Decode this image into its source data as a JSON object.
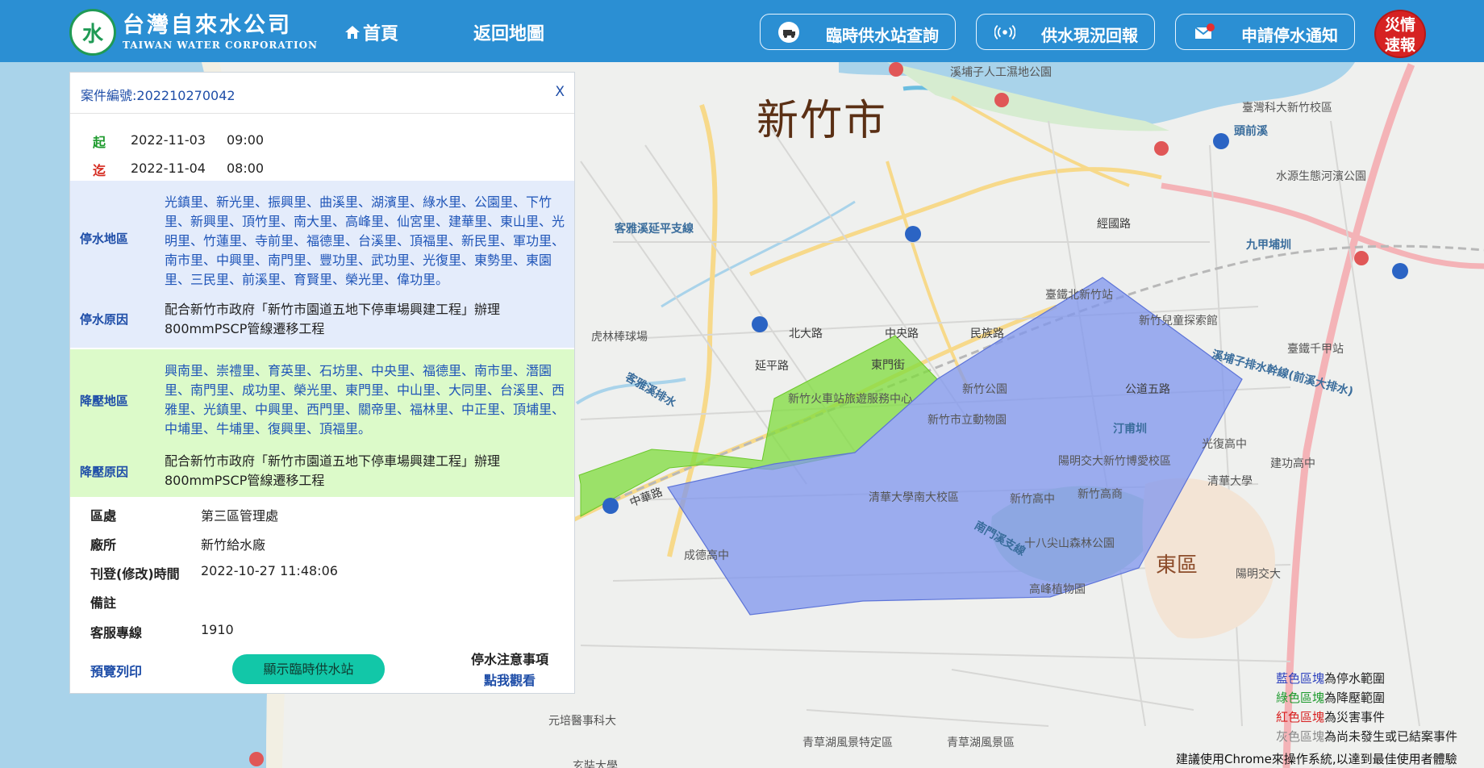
{
  "header": {
    "logo_zh": "台灣自來水公司",
    "logo_en": "TAIWAN WATER CORPORATION",
    "nav_home": "首頁",
    "nav_back": "返回地圖",
    "btn_station": "臨時供水站查詢",
    "btn_report": "供水現況回報",
    "btn_notify": "申請停水通知",
    "disaster": "災情速報"
  },
  "panel": {
    "case_no": "案件編號:202210270042",
    "close": "X",
    "start_key": "起",
    "start_date": "2022-11-03",
    "start_time": "09:00",
    "end_key": "迄",
    "end_date": "2022-11-04",
    "end_time": "08:00",
    "stop_area_label": "停水地區",
    "stop_area": "光鎮里、新光里、振興里、曲溪里、湖濱里、綠水里、公園里、下竹里、新興里、頂竹里、南大里、高峰里、仙宮里、建華里、東山里、光明里、竹蓮里、寺前里、福德里、台溪里、頂福里、新民里、軍功里、南市里、中興里、南門里、豐功里、武功里、光復里、東勢里、東園里、三民里、前溪里、育賢里、榮光里、偉功里。",
    "stop_reason_label": "停水原因",
    "stop_reason": "配合新竹市政府「新竹市園道五地下停車場興建工程」辦理800mmPSCP管線遷移工程",
    "press_area_label": "降壓地區",
    "press_area": "興南里、崇禮里、育英里、石坊里、中央里、福德里、南市里、潛園里、南門里、成功里、榮光里、東門里、中山里、大同里、台溪里、西雅里、光鎮里、中興里、西門里、關帝里、福林里、中正里、頂埔里、中埔里、牛埔里、復興里、頂福里。",
    "press_reason_label": "降壓原因",
    "press_reason": "配合新竹市政府「新竹市園道五地下停車場興建工程」辦理800mmPSCP管線遷移工程",
    "district_label": "區處",
    "district": "第三區管理處",
    "plant_label": "廠所",
    "plant": "新竹給水廠",
    "published_label": "刊登(修改)時間",
    "published": "2022-10-27 11:48:06",
    "note_label": "備註",
    "note": "",
    "hotline_label": "客服專線",
    "hotline": "1910",
    "print": "預覽列印",
    "show_station": "顯示臨時供水站",
    "notice_title": "停水注意事項",
    "notice_link": "點我觀看"
  },
  "map": {
    "city": "新竹市",
    "district": "東區",
    "labels": {
      "l1": "溪埔子人工濕地公園",
      "l2": "臺灣科大新竹校區",
      "l3": "水源生態河濱公園",
      "l4": "客雅溪延平支線",
      "l5": "虎林棒球場",
      "l6": "新竹火車站旅遊服務中心",
      "l7": "新竹市立動物園",
      "l8": "新竹公園",
      "l9": "新竹兒童探索館",
      "l10": "臺鐵千甲站",
      "l11": "臺鐵北新竹站",
      "l12": "陽明交大新竹博愛校區",
      "l13": "清華大學南大校區",
      "l14": "新竹高中",
      "l15": "新竹高商",
      "l16": "十八尖山森林公園",
      "l17": "高峰植物園",
      "l18": "成德高中",
      "l19": "光復高中",
      "l20": "建功高中",
      "l21": "清華大學",
      "l22": "陽明交大",
      "l23": "元培醫事科大",
      "l24": "青草湖風景特定區",
      "l25": "青草湖風景區",
      "l26": "九甲埔圳",
      "l27": "客雅溪排水",
      "l28": "汀甫圳",
      "l29": "經國路",
      "l30": "中華路",
      "l31": "東門街",
      "l32": "民族路",
      "l33": "中央路",
      "l34": "北大路",
      "l35": "延平路",
      "l36": "公道五路",
      "l37": "南門溪支線",
      "l38": "溪埔子排水幹線(前溪大排水)",
      "l39": "頭前溪",
      "l40": "玄奘大學"
    }
  },
  "legend": {
    "blue": "藍色區塊",
    "blue_text": "為停水範圍",
    "green": "綠色區塊",
    "green_text": "為降壓範圍",
    "red": "紅色區塊",
    "red_text": "為災害事件",
    "gray": "灰色區塊",
    "gray_text": "為尚未發生或已結案事件"
  },
  "hint": "建議使用Chrome來操作系統,以達到最佳使用者體驗",
  "colors": {
    "header": "#2b8fd3",
    "stop_area_fill": "#8ba6f0",
    "pressure_area_fill": "#7fdc3c",
    "disaster": "#d62222"
  }
}
